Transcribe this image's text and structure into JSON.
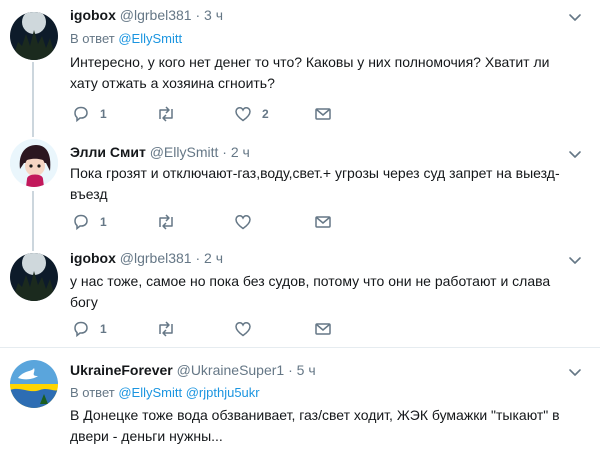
{
  "tweets": [
    {
      "name": "igobox",
      "handle": "@lgrbel381",
      "dot": "·",
      "time": "3 ч",
      "reply_prefix": "В ответ",
      "reply_to": [
        "@EllySmitt"
      ],
      "text_lines": [
        "Интересно, у кого нет денег то что? Каковы у них полномочия? Хватит ли",
        "хату отжать  а хозяина сгноить?"
      ],
      "reply_count": "1",
      "retweet_count": "",
      "like_count": "2"
    },
    {
      "name": "Элли Смит",
      "handle": "@EllySmitt",
      "dot": "·",
      "time": "2 ч",
      "text_lines": [
        "Пока грозят и отключают-газ,воду,свет.+ угрозы через суд запрет на выезд-",
        "въезд"
      ],
      "reply_count": "1",
      "retweet_count": "",
      "like_count": ""
    },
    {
      "name": "igobox",
      "handle": "@lgrbel381",
      "dot": "·",
      "time": "2 ч",
      "text_lines": [
        "у нас тоже, самое но пока без судов, потому что они не работают и слава",
        "богу"
      ],
      "reply_count": "1",
      "retweet_count": "",
      "like_count": ""
    },
    {
      "name": "UkraineForever",
      "handle": "@UkraineSuper1",
      "dot": "·",
      "time": "5 ч",
      "reply_prefix": "В ответ",
      "reply_to": [
        "@EllySmitt",
        "@rjpthju5ukr"
      ],
      "text_lines": [
        "В Донецке тоже вода обзванивает, газ/свет ходит, ЖЭК бумажки \"тыкают\" в",
        "двери - деньги нужны..."
      ]
    }
  ],
  "icons": {
    "reply": "reply-icon",
    "retweet": "retweet-icon",
    "like": "heart-icon",
    "dm": "envelope-icon",
    "caret": "chevron-down-icon"
  },
  "colors": {
    "text": "#14171a",
    "muted": "#657786",
    "link": "#1b95e0",
    "divider": "#e6ecf0",
    "thread_line": "#ccd6dd"
  }
}
